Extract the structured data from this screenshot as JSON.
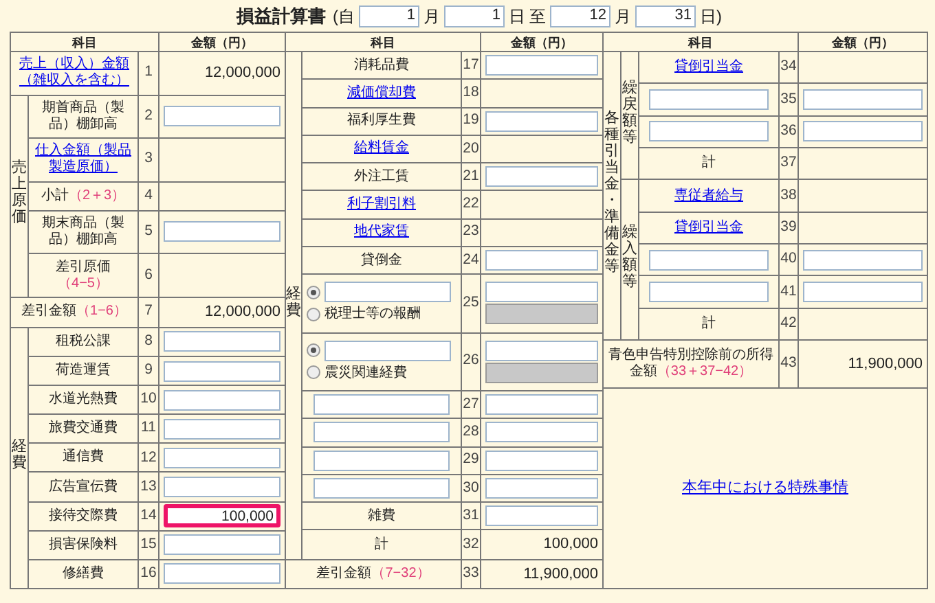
{
  "title": "損益計算書",
  "period": [
    {
      "kind": "text",
      "text": "(自"
    },
    {
      "kind": "field",
      "value": "1"
    },
    {
      "kind": "text",
      "text": "月"
    },
    {
      "kind": "field",
      "value": "1"
    },
    {
      "kind": "text",
      "text": "日"
    },
    {
      "kind": "text",
      "text": "至"
    },
    {
      "kind": "field",
      "value": "12"
    },
    {
      "kind": "text",
      "text": "月"
    },
    {
      "kind": "field",
      "value": "31"
    },
    {
      "kind": "text",
      "text": "日)"
    }
  ],
  "panels": [
    {
      "headers": [
        "科目",
        "金額（円）"
      ],
      "items": [
        {
          "kind": "row",
          "no": "1",
          "label": {
            "kind": "link",
            "text": "売上（収入）金額（雑収入を含む）"
          },
          "amount": {
            "kind": "text",
            "text": "12,000,000"
          }
        },
        {
          "kind": "group",
          "label": "売上原価",
          "rows": [
            {
              "kind": "row",
              "no": "2",
              "label": {
                "kind": "text",
                "text": "期首商品（製品）棚卸高"
              },
              "amount": {
                "kind": "input",
                "highlighted": false
              }
            },
            {
              "kind": "row",
              "no": "3",
              "label": {
                "kind": "link",
                "text": "仕入金額（製品製造原価）"
              },
              "amount": {
                "kind": "blank"
              }
            },
            {
              "kind": "row",
              "no": "4",
              "label": {
                "kind": "text",
                "text": "小計",
                "formula": "（2＋3）"
              },
              "amount": {
                "kind": "blank"
              }
            },
            {
              "kind": "row",
              "no": "5",
              "label": {
                "kind": "text",
                "text": "期末商品（製品）棚卸高"
              },
              "amount": {
                "kind": "input",
                "highlighted": false
              }
            },
            {
              "kind": "row",
              "no": "6",
              "label": {
                "kind": "text",
                "text": "差引原価",
                "formula": "（4−5）"
              },
              "amount": {
                "kind": "blank"
              }
            }
          ]
        },
        {
          "kind": "row",
          "no": "7",
          "label": {
            "kind": "text",
            "text": "差引金額",
            "formula": "（1−6）"
          },
          "amount": {
            "kind": "text",
            "text": "12,000,000"
          }
        },
        {
          "kind": "group",
          "label": "経費",
          "rows": [
            {
              "kind": "row",
              "no": "8",
              "label": {
                "kind": "text",
                "text": "租税公課"
              },
              "amount": {
                "kind": "input",
                "highlighted": false
              }
            },
            {
              "kind": "row",
              "no": "9",
              "label": {
                "kind": "text",
                "text": "荷造運賃"
              },
              "amount": {
                "kind": "input",
                "highlighted": false
              }
            },
            {
              "kind": "row",
              "no": "10",
              "label": {
                "kind": "text",
                "text": "水道光熱費"
              },
              "amount": {
                "kind": "input",
                "highlighted": false
              }
            },
            {
              "kind": "row",
              "no": "11",
              "label": {
                "kind": "text",
                "text": "旅費交通費"
              },
              "amount": {
                "kind": "input",
                "highlighted": false
              }
            },
            {
              "kind": "row",
              "no": "12",
              "label": {
                "kind": "text",
                "text": "通信費"
              },
              "amount": {
                "kind": "input",
                "highlighted": false
              }
            },
            {
              "kind": "row",
              "no": "13",
              "label": {
                "kind": "text",
                "text": "広告宣伝費"
              },
              "amount": {
                "kind": "input",
                "highlighted": false
              }
            },
            {
              "kind": "row",
              "no": "14",
              "label": {
                "kind": "text",
                "text": "接待交際費"
              },
              "amount": {
                "kind": "input",
                "value": "100,000",
                "highlighted": true
              }
            },
            {
              "kind": "row",
              "no": "15",
              "label": {
                "kind": "text",
                "text": "損害保険料"
              },
              "amount": {
                "kind": "input",
                "highlighted": false
              }
            },
            {
              "kind": "row",
              "no": "16",
              "label": {
                "kind": "text",
                "text": "修繕費"
              },
              "amount": {
                "kind": "input",
                "highlighted": false
              }
            }
          ]
        }
      ]
    },
    {
      "headers": [
        "科目",
        "金額（円）"
      ],
      "items": [
        {
          "kind": "group",
          "label": "経費",
          "rows": [
            {
              "kind": "row",
              "no": "17",
              "label": {
                "kind": "text",
                "text": "消耗品費"
              },
              "amount": {
                "kind": "input",
                "highlighted": false
              }
            },
            {
              "kind": "row",
              "no": "18",
              "label": {
                "kind": "link",
                "text": "減価償却費"
              },
              "amount": {
                "kind": "blank"
              }
            },
            {
              "kind": "row",
              "no": "19",
              "label": {
                "kind": "text",
                "text": "福利厚生費"
              },
              "amount": {
                "kind": "input",
                "highlighted": false
              }
            },
            {
              "kind": "row",
              "no": "20",
              "label": {
                "kind": "link",
                "text": "給料賃金"
              },
              "amount": {
                "kind": "blank"
              }
            },
            {
              "kind": "row",
              "no": "21",
              "label": {
                "kind": "text",
                "text": "外注工賃"
              },
              "amount": {
                "kind": "input",
                "highlighted": false
              }
            },
            {
              "kind": "row",
              "no": "22",
              "label": {
                "kind": "link",
                "text": "利子割引料"
              },
              "amount": {
                "kind": "blank"
              }
            },
            {
              "kind": "row",
              "no": "23",
              "label": {
                "kind": "link",
                "text": "地代家賃"
              },
              "amount": {
                "kind": "blank"
              }
            },
            {
              "kind": "row",
              "no": "24",
              "label": {
                "kind": "text",
                "text": "貸倒金"
              },
              "amount": {
                "kind": "input",
                "highlighted": false
              }
            },
            {
              "kind": "row",
              "no": "25",
              "label": {
                "kind": "radio",
                "options": [
                  {
                    "kind": "field",
                    "selected": true
                  },
                  {
                    "kind": "text",
                    "text": "税理士等の報酬",
                    "selected": false
                  }
                ]
              },
              "amount": {
                "kind": "input_pair",
                "highlighted": false
              }
            },
            {
              "kind": "row",
              "no": "26",
              "label": {
                "kind": "radio",
                "options": [
                  {
                    "kind": "field",
                    "selected": true
                  },
                  {
                    "kind": "text",
                    "text": "震災関連経費",
                    "selected": false
                  }
                ]
              },
              "amount": {
                "kind": "input_pair",
                "highlighted": false
              }
            },
            {
              "kind": "row",
              "no": "27",
              "label": {
                "kind": "input"
              },
              "amount": {
                "kind": "input",
                "highlighted": false
              }
            },
            {
              "kind": "row",
              "no": "28",
              "label": {
                "kind": "input"
              },
              "amount": {
                "kind": "input",
                "highlighted": false
              }
            },
            {
              "kind": "row",
              "no": "29",
              "label": {
                "kind": "input"
              },
              "amount": {
                "kind": "input",
                "highlighted": false
              }
            },
            {
              "kind": "row",
              "no": "30",
              "label": {
                "kind": "input"
              },
              "amount": {
                "kind": "input",
                "highlighted": false
              }
            },
            {
              "kind": "row",
              "no": "31",
              "label": {
                "kind": "text",
                "text": "雑費"
              },
              "amount": {
                "kind": "input",
                "highlighted": false
              }
            },
            {
              "kind": "row",
              "no": "32",
              "label": {
                "kind": "text",
                "text": "計"
              },
              "amount": {
                "kind": "text",
                "text": "100,000"
              }
            }
          ]
        },
        {
          "kind": "row",
          "no": "33",
          "label": {
            "kind": "text",
            "text": "差引金額",
            "formula": "（7−32）"
          },
          "amount": {
            "kind": "text",
            "text": "11,900,000"
          }
        }
      ]
    },
    {
      "headers": [
        "科目",
        "金額（円）"
      ],
      "items": [
        {
          "kind": "group",
          "label": "各種引当金・準備金等",
          "rows": [
            {
              "kind": "group",
              "label": "繰戻額等",
              "rows": [
                {
                  "kind": "row",
                  "no": "34",
                  "label": {
                    "kind": "link",
                    "text": "貸倒引当金"
                  },
                  "amount": {
                    "kind": "blank"
                  }
                },
                {
                  "kind": "row",
                  "no": "35",
                  "label": {
                    "kind": "input"
                  },
                  "amount": {
                    "kind": "input",
                    "highlighted": false
                  }
                },
                {
                  "kind": "row",
                  "no": "36",
                  "label": {
                    "kind": "input"
                  },
                  "amount": {
                    "kind": "input",
                    "highlighted": false
                  }
                },
                {
                  "kind": "row",
                  "no": "37",
                  "label": {
                    "kind": "text",
                    "text": "計"
                  },
                  "amount": {
                    "kind": "blank"
                  }
                }
              ]
            },
            {
              "kind": "group",
              "label": "繰入額等",
              "rows": [
                {
                  "kind": "row",
                  "no": "38",
                  "label": {
                    "kind": "link",
                    "text": "専従者給与"
                  },
                  "amount": {
                    "kind": "blank"
                  }
                },
                {
                  "kind": "row",
                  "no": "39",
                  "label": {
                    "kind": "link",
                    "text": "貸倒引当金"
                  },
                  "amount": {
                    "kind": "blank"
                  }
                },
                {
                  "kind": "row",
                  "no": "40",
                  "label": {
                    "kind": "input"
                  },
                  "amount": {
                    "kind": "input",
                    "highlighted": false
                  }
                },
                {
                  "kind": "row",
                  "no": "41",
                  "label": {
                    "kind": "input"
                  },
                  "amount": {
                    "kind": "input",
                    "highlighted": false
                  }
                },
                {
                  "kind": "row",
                  "no": "42",
                  "label": {
                    "kind": "text",
                    "text": "計"
                  },
                  "amount": {
                    "kind": "blank"
                  }
                }
              ]
            }
          ]
        },
        {
          "kind": "row",
          "no": "43",
          "label": {
            "kind": "text",
            "text": "青色申告特別控除前の所得金額",
            "formula": "（33＋37−42）"
          },
          "amount": {
            "kind": "text",
            "text": "11,900,000"
          }
        },
        {
          "kind": "note_link",
          "label": "本年中における特殊事情"
        }
      ]
    }
  ]
}
